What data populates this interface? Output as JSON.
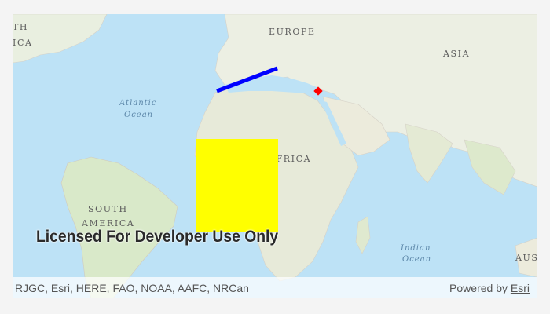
{
  "map": {
    "labels": {
      "europe": "EUROPE",
      "asia": "ASIA",
      "africa": "AFRICA",
      "south_america_1": "SOUTH",
      "south_america_2": "AMERICA",
      "atlantic_1": "Atlantic",
      "atlantic_2": "Ocean",
      "indian_1": "Indian",
      "indian_2": "Ocean",
      "north_america_partial": "TH",
      "north_america_partial2": "ICA",
      "australia_partial": "AUS"
    },
    "graphics": {
      "polyline_color": "#0000ff",
      "point_color": "#ff0000",
      "polygon_color": "#ffff00"
    },
    "watermark": "Licensed For Developer Use Only"
  },
  "attribution": {
    "sources": "RJGC, Esri, HERE, FAO, NOAA, AAFC, NRCan",
    "powered_by_prefix": "Powered by ",
    "powered_by_link": "Esri"
  }
}
